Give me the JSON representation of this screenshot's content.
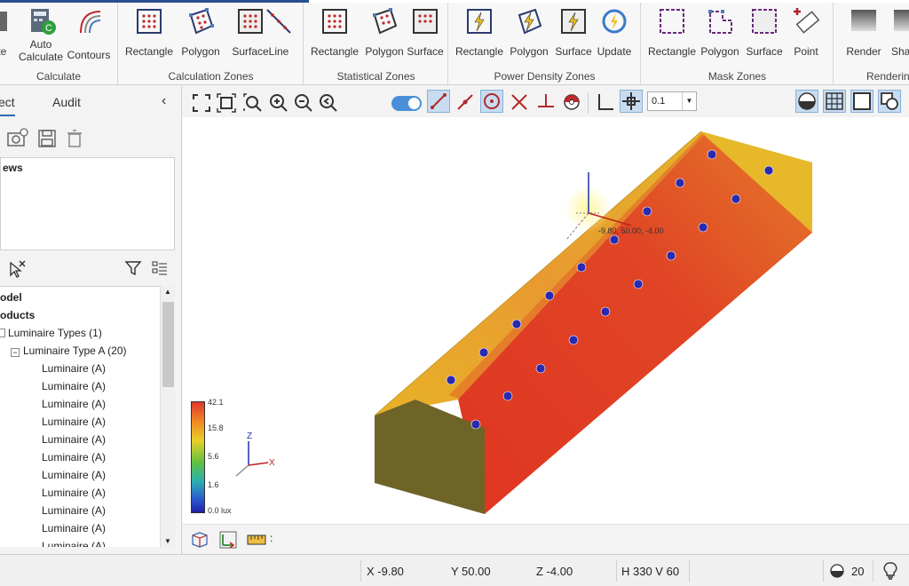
{
  "ribbon": {
    "calculate": {
      "label": "Calculate",
      "buttons": [
        "ate",
        "Auto\nCalculate",
        "Contours"
      ]
    },
    "calc_zones": {
      "label": "Calculation Zones",
      "buttons": [
        "Rectangle",
        "Polygon",
        "Surface",
        "Line"
      ]
    },
    "stat_zones": {
      "label": "Statistical Zones",
      "buttons": [
        "Rectangle",
        "Polygon",
        "Surface"
      ]
    },
    "power_zones": {
      "label": "Power Density Zones",
      "buttons": [
        "Rectangle",
        "Polygon",
        "Surface",
        "Update"
      ]
    },
    "mask_zones": {
      "label": "Mask Zones",
      "buttons": [
        "Rectangle",
        "Polygon",
        "Surface",
        "Point"
      ]
    },
    "rendering": {
      "label": "Rendering",
      "buttons": [
        "Render",
        "Shad"
      ]
    }
  },
  "panel": {
    "tabs": [
      "ect",
      "Audit"
    ],
    "views_label": "ews",
    "tree": [
      "odel",
      "oducts",
      "Luminaire Types (1)",
      "Luminaire Type A (20)",
      "Luminaire  (A)",
      "Luminaire  (A)",
      "Luminaire  (A)",
      "Luminaire  (A)",
      "Luminaire  (A)",
      "Luminaire  (A)",
      "Luminaire  (A)",
      "Luminaire  (A)",
      "Luminaire  (A)",
      "Luminaire  (A)",
      "Luminaire  (A)"
    ]
  },
  "toolbar": {
    "grid_value": "0.1"
  },
  "viewport": {
    "coord_label": "-9.80, 50.00, -4.00",
    "legend": [
      "42.1",
      "15.8",
      "5.6",
      "1.6",
      "0.0 lux"
    ],
    "axis_z": "Z",
    "axis_x": "X",
    "colors": {
      "hot": "#e03a22",
      "warm": "#e8b82a",
      "wall": "#6e6428"
    }
  },
  "bottombar": {
    "measure": ":"
  },
  "status": {
    "x": "X  -9.80",
    "y": "Y  50.00",
    "z": "Z  -4.00",
    "hv": "H 330  V 60",
    "count": "20"
  }
}
